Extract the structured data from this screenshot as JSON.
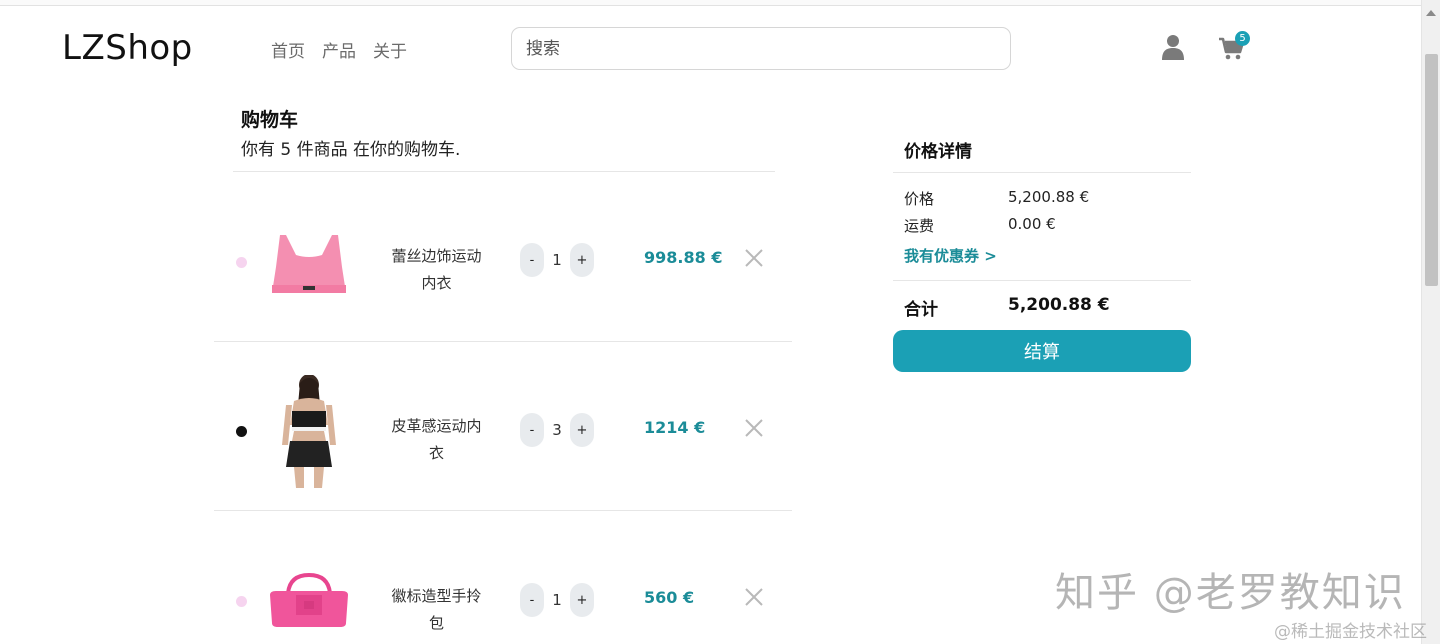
{
  "header": {
    "logo": "LZShop",
    "nav": [
      "首页",
      "产品",
      "关于"
    ],
    "search_placeholder": "搜索",
    "cart_count": "5"
  },
  "cart": {
    "title": "购物车",
    "subtitle": "你有 5 件商品 在你的购物车.",
    "items": [
      {
        "name_line1": "蕾丝边饰运动",
        "name_line2": "内衣",
        "qty": "1",
        "price": "998.88 €",
        "dot_color": "#f6d4ef",
        "minus": "-",
        "plus": "+"
      },
      {
        "name_line1": "皮革感运动内",
        "name_line2": "衣",
        "qty": "3",
        "price": "1214 €",
        "dot_color": "#111111",
        "minus": "-",
        "plus": "+"
      },
      {
        "name_line1": "徽标造型手拎",
        "name_line2": "包",
        "qty": "1",
        "price": "560 €",
        "dot_color": "#f6d4ef",
        "minus": "-",
        "plus": "+"
      }
    ]
  },
  "summary": {
    "title": "价格详情",
    "price_label": "价格",
    "price_value": "5,200.88 €",
    "shipping_label": "运费",
    "shipping_value": "0.00 €",
    "coupon": "我有优惠券 >",
    "total_label": "合计",
    "total_value": "5,200.88 €",
    "checkout": "结算"
  },
  "watermark": {
    "main": "知乎 @老罗教知识",
    "sub": "@稀土掘金技术社区"
  },
  "colors": {
    "accent": "#1ba0b5",
    "price": "#1b8c98"
  },
  "icons": {
    "user": "user-icon",
    "cart": "cart-icon",
    "remove": "close-icon"
  }
}
